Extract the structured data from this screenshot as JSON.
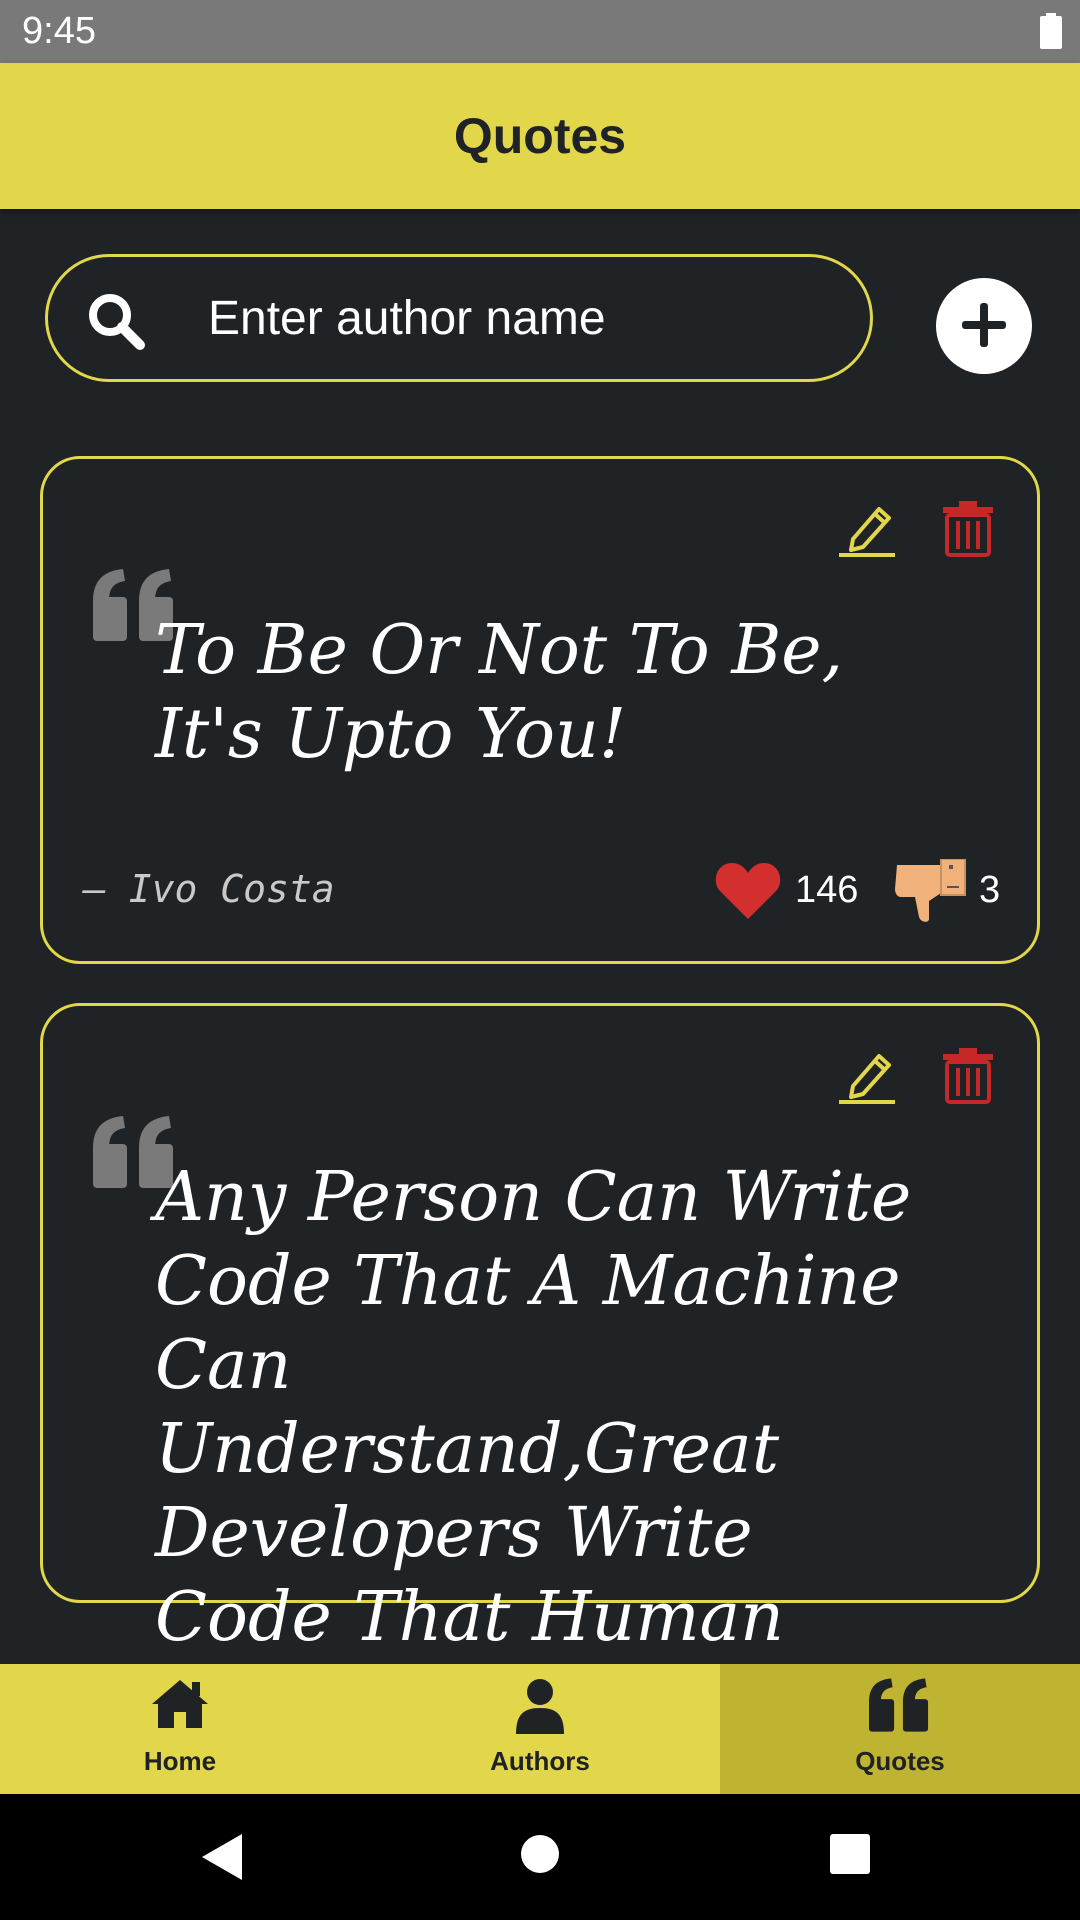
{
  "status_bar": {
    "time": "9:45",
    "battery_icon": "battery-icon"
  },
  "app_bar": {
    "title": "Quotes"
  },
  "search": {
    "placeholder": "Enter author name",
    "value": "",
    "icon": "search-icon"
  },
  "add_button": {
    "icon": "plus-icon"
  },
  "quotes": [
    {
      "text": "To Be Or Not To Be, It's Upto You!",
      "author": "– Ivo Costa",
      "likes": "146",
      "dislikes": "3"
    },
    {
      "text": "Any Person Can Write Code That A Machine Can Understand,Great Developers Write Code That Human Understands.",
      "author": "",
      "likes": "",
      "dislikes": ""
    }
  ],
  "bottom_nav": {
    "items": [
      {
        "label": "Home",
        "icon": "home-icon",
        "active": false
      },
      {
        "label": "Authors",
        "icon": "person-icon",
        "active": false
      },
      {
        "label": "Quotes",
        "icon": "quote-icon",
        "active": true
      }
    ]
  },
  "colors": {
    "accent": "#e2d64b",
    "accent_active": "#beb432",
    "background": "#202326",
    "delete": "#c62828",
    "like": "#d32f2f",
    "dislike": "#f0b27a",
    "quote_mark": "#7a7a7a"
  }
}
